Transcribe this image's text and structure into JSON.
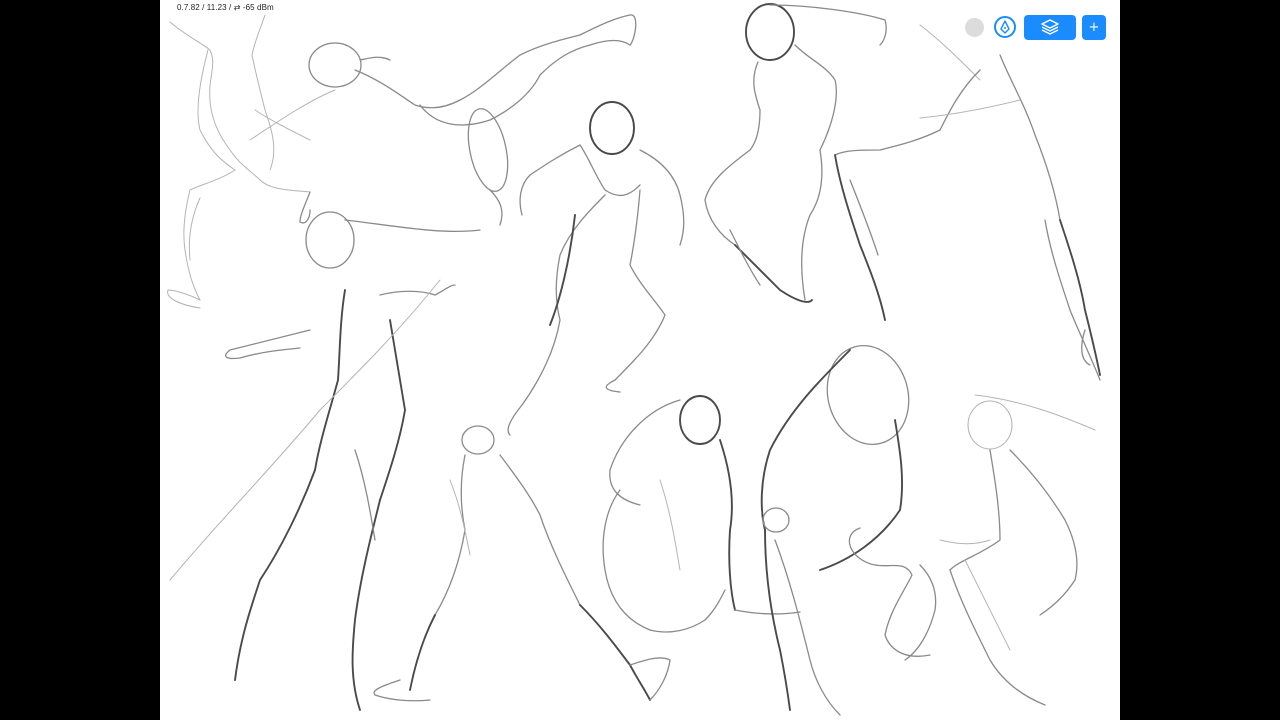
{
  "status_bar": {
    "text": "0.7.82 / 11.23 / ⇄ -65 dBm"
  },
  "toolbar": {
    "color_swatch": {
      "icon": "color-swatch-icon",
      "color": "#dcdcdc"
    },
    "pen_tool": {
      "icon": "pen-nib-icon",
      "color": "#1a8cff"
    },
    "layers": {
      "icon": "layers-icon",
      "color": "#1a8cff"
    },
    "add": {
      "label": "+",
      "color": "#1a8cff"
    }
  },
  "canvas": {
    "background": "#ffffff",
    "content": "figure gesture sketches"
  }
}
